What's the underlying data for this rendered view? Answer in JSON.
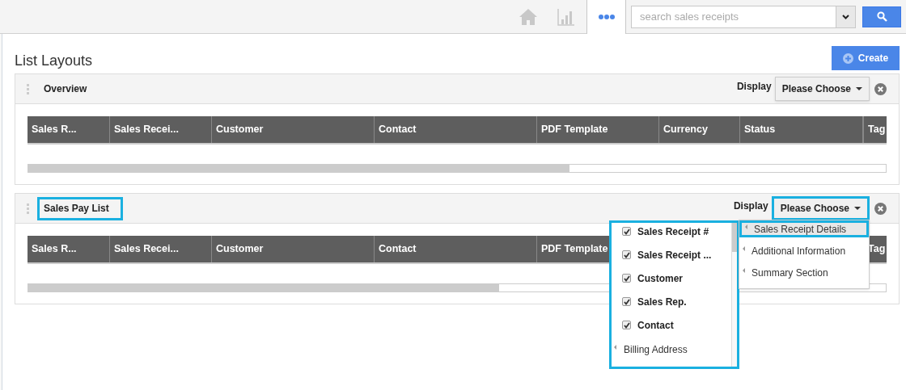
{
  "top_bar": {
    "more_tab": {
      "selected": true
    },
    "search": {
      "placeholder": "search sales receipts"
    }
  },
  "page": {
    "title": "List Layouts",
    "create_button": "Create"
  },
  "layouts": [
    {
      "title": "Overview",
      "highlighted": false,
      "display_label": "Display",
      "display_button": {
        "label": "Please Choose",
        "highlighted": false
      },
      "columns": [
        "Sales R...",
        "Sales Recei...",
        "Customer",
        "Contact",
        "PDF Template",
        "Currency",
        "Status",
        "Tag"
      ]
    },
    {
      "title": "Sales Pay List",
      "highlighted": true,
      "display_label": "Display",
      "display_button": {
        "label": "Please Choose",
        "highlighted": true
      },
      "columns": [
        "Sales R...",
        "Sales Recei...",
        "Customer",
        "Contact",
        "PDF Template",
        "Tag"
      ],
      "column_picker": {
        "highlighted": true,
        "items": [
          {
            "kind": "checkbox",
            "label": "Sales Receipt #",
            "checked": true
          },
          {
            "kind": "checkbox",
            "label": "Sales Receipt ...",
            "checked": true
          },
          {
            "kind": "checkbox",
            "label": "Customer",
            "checked": true
          },
          {
            "kind": "checkbox",
            "label": "Sales Rep.",
            "checked": true
          },
          {
            "kind": "checkbox",
            "label": "Contact",
            "checked": true
          },
          {
            "kind": "group",
            "label": "Billing Address"
          }
        ]
      },
      "display_menu": {
        "items": [
          {
            "label": "Sales Receipt Details",
            "selected": true
          },
          {
            "label": "Additional Information",
            "selected": false
          },
          {
            "label": "Summary Section",
            "selected": false
          }
        ]
      }
    }
  ]
}
